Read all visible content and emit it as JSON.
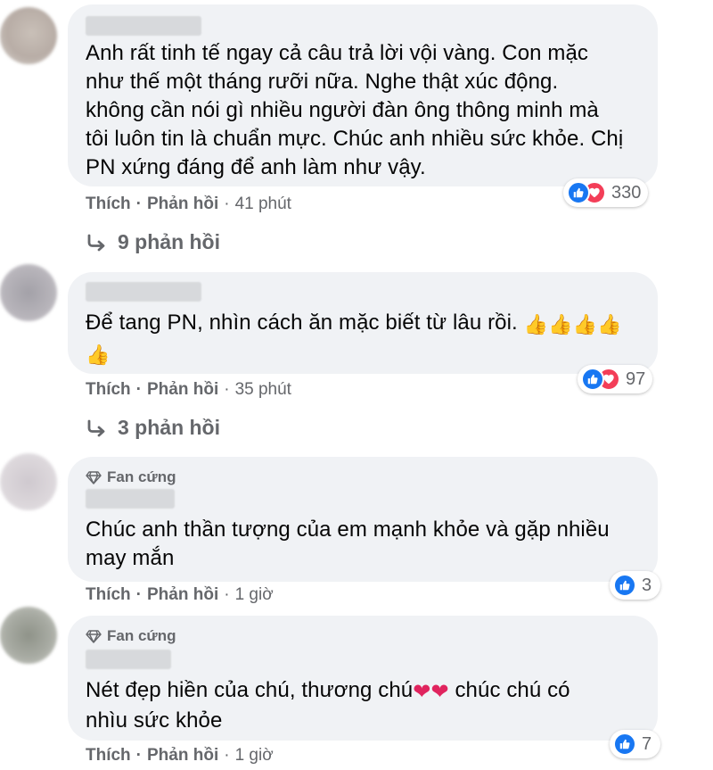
{
  "comments": [
    {
      "badge": "",
      "text_lines": [
        "Anh rất tinh tế ngay cả câu trả lời vội vàng. Con mặc",
        "như thế một tháng rưỡi nữa. Nghe thật xúc động.",
        "không cần nói gì nhiều người đàn ông thông minh mà",
        "tôi luôn tin là chuẩn mực. Chúc anh nhiều sức khỏe. Chị",
        "PN xứng đáng để anh làm như vậy."
      ],
      "reaction_count": "330",
      "reaction_types": [
        "like-icon",
        "heart-icon"
      ],
      "like_label": "Thích",
      "reply_label": "Phản hồi",
      "time": "41 phút",
      "replies_label": "9 phản hồi"
    },
    {
      "badge": "",
      "text_lines": [
        "Để tang PN, nhìn cách ăn mặc biết từ lâu rồi. "
      ],
      "emoji": "thumbs-up x5",
      "reaction_count": "97",
      "reaction_types": [
        "like-icon",
        "heart-icon"
      ],
      "like_label": "Thích",
      "reply_label": "Phản hồi",
      "time": "35 phút",
      "replies_label": "3 phản hồi"
    },
    {
      "badge": "Fan cứng",
      "text_lines": [
        "Chúc anh thần tượng của em mạnh khỏe và gặp nhiều",
        "may mắn"
      ],
      "reaction_count": "3",
      "reaction_types": [
        "like-icon"
      ],
      "like_label": "Thích",
      "reply_label": "Phản hồi",
      "time": "1 giờ"
    },
    {
      "badge": "Fan cứng",
      "text_line_1_a": "Nét đẹp hiền của chú, thương chú",
      "text_line_1_b": " chúc chú có",
      "text_line_2": "nhìu sức khỏe",
      "emoji": "red-heart x2",
      "reaction_count": "7",
      "reaction_types": [
        "like-icon"
      ],
      "like_label": "Thích",
      "reply_label": "Phản hồi",
      "time": "1 giờ"
    }
  ],
  "colors": {
    "bubble_bg": "#f0f2f5",
    "secondary_text": "#65676b",
    "like_blue": "#1877f2",
    "love_red": "#f33e58"
  }
}
